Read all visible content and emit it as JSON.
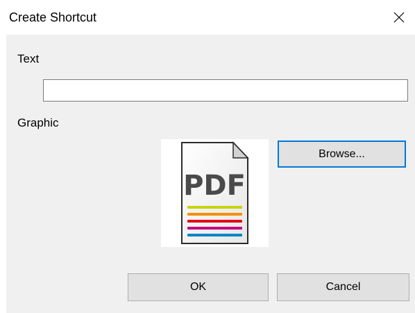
{
  "window": {
    "title": "Create Shortcut"
  },
  "form": {
    "text_label": "Text",
    "text_value": "",
    "graphic_label": "Graphic",
    "graphic_icon": "pdf-file-icon",
    "graphic_icon_text": "PDF"
  },
  "buttons": {
    "browse_label": "Browse...",
    "ok_label": "OK",
    "cancel_label": "Cancel"
  },
  "colors": {
    "client_background": "#f0f0f0",
    "button_background": "#e1e1e1",
    "focus_border": "#0078d7",
    "pdf_stripes": [
      "#c8d400",
      "#f29100",
      "#e30a17",
      "#c6007e",
      "#0085c7"
    ]
  }
}
